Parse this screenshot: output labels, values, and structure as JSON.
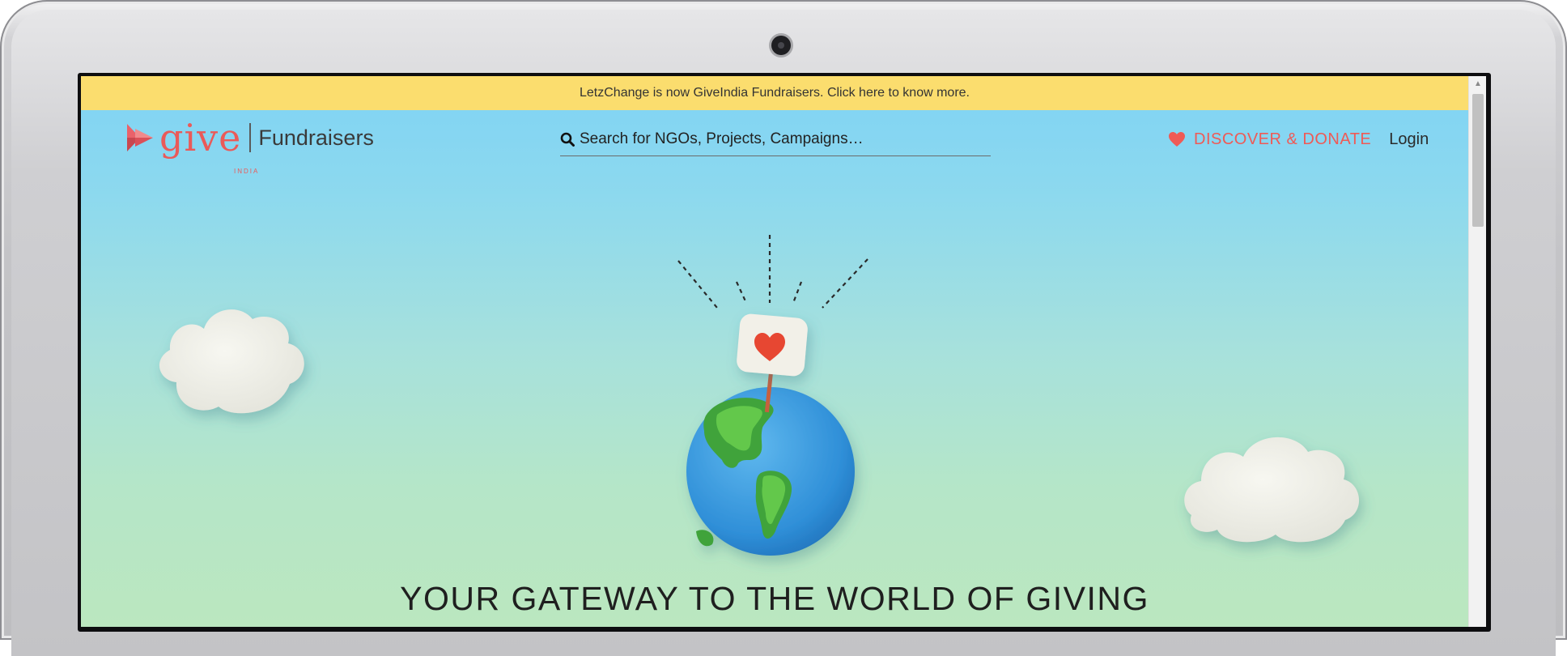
{
  "announcement": {
    "text": "LetzChange is now GiveIndia Fundraisers. Click here to know more."
  },
  "header": {
    "logo_word": "give",
    "logo_subword": "INDIA",
    "logo_product": "Fundraisers",
    "search_placeholder": "Search for NGOs, Projects, Campaigns…",
    "discover_label": "DISCOVER & DONATE",
    "login_label": "Login"
  },
  "hero": {
    "title": "YOUR GATEWAY TO THE WORLD OF GIVING"
  },
  "colors": {
    "brand_red": "#ea5a59",
    "announcement_bg": "#fbdd6e",
    "sky_top": "#7fd3f5",
    "sky_bottom": "#bbe7bf"
  },
  "icons": {
    "search": "search-icon",
    "heart": "heart-icon",
    "logo_mark": "arrow-triangle-logo-icon"
  }
}
